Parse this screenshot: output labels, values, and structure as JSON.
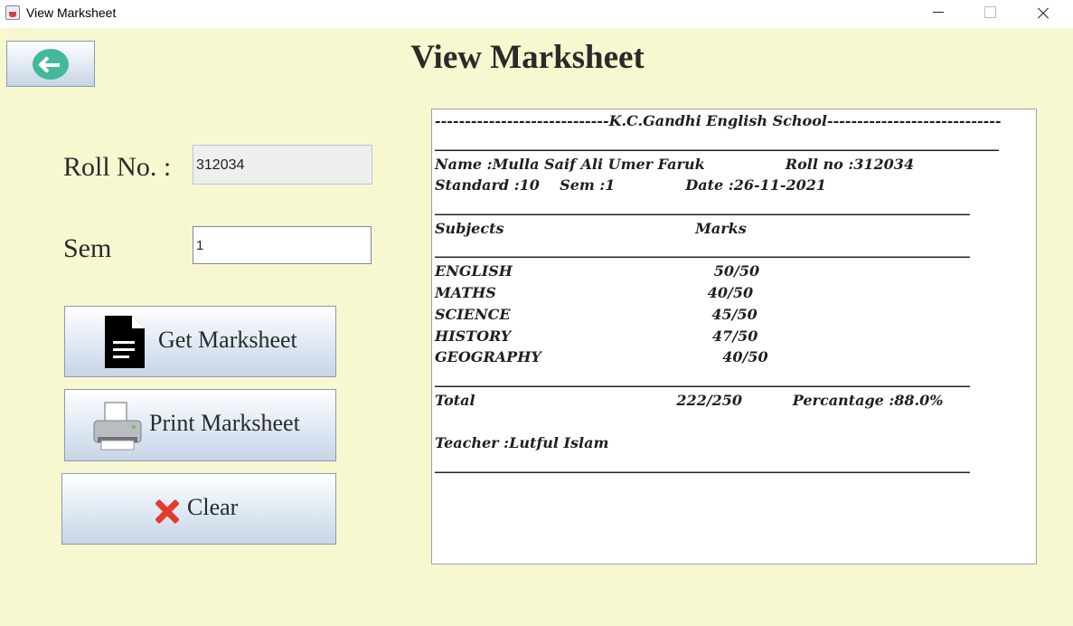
{
  "window": {
    "title": "View Marksheet"
  },
  "header": {
    "title": "View Marksheet"
  },
  "form": {
    "roll_label": "Roll No. :",
    "roll_value": "312034",
    "sem_label": "Sem",
    "sem_value": "1"
  },
  "buttons": {
    "get": "Get Marksheet",
    "print": "Print Marksheet",
    "clear": "Clear"
  },
  "sheet": {
    "lines": [
      "-----------------------------K.C.Gandhi English School-----------------------------",
      "______________________________________________________________________________",
      "Name :Mulla Saif Ali Umer Faruk                Roll no :312034",
      "Standard :10    Sem :1              Date :26-11-2021",
      "__________________________________________________________________________",
      "Subjects                                      Marks",
      "__________________________________________________________________________",
      "ENGLISH                                        50/50",
      "MATHS                                          40/50",
      "SCIENCE                                        45/50",
      "HISTORY                                        47/50",
      "GEOGRAPHY                                    40/50",
      "__________________________________________________________________________",
      "Total                                        222/250          Percantage :88.0%",
      "",
      "Teacher :Lutful Islam",
      "__________________________________________________________________________"
    ]
  },
  "icons": {
    "back": "arrow-left-circle",
    "get": "document",
    "print": "printer",
    "clear": "red-x"
  },
  "colors": {
    "background": "#f7f7d0",
    "back_icon": "#43b89a",
    "clear_icon": "#e23b2f"
  }
}
